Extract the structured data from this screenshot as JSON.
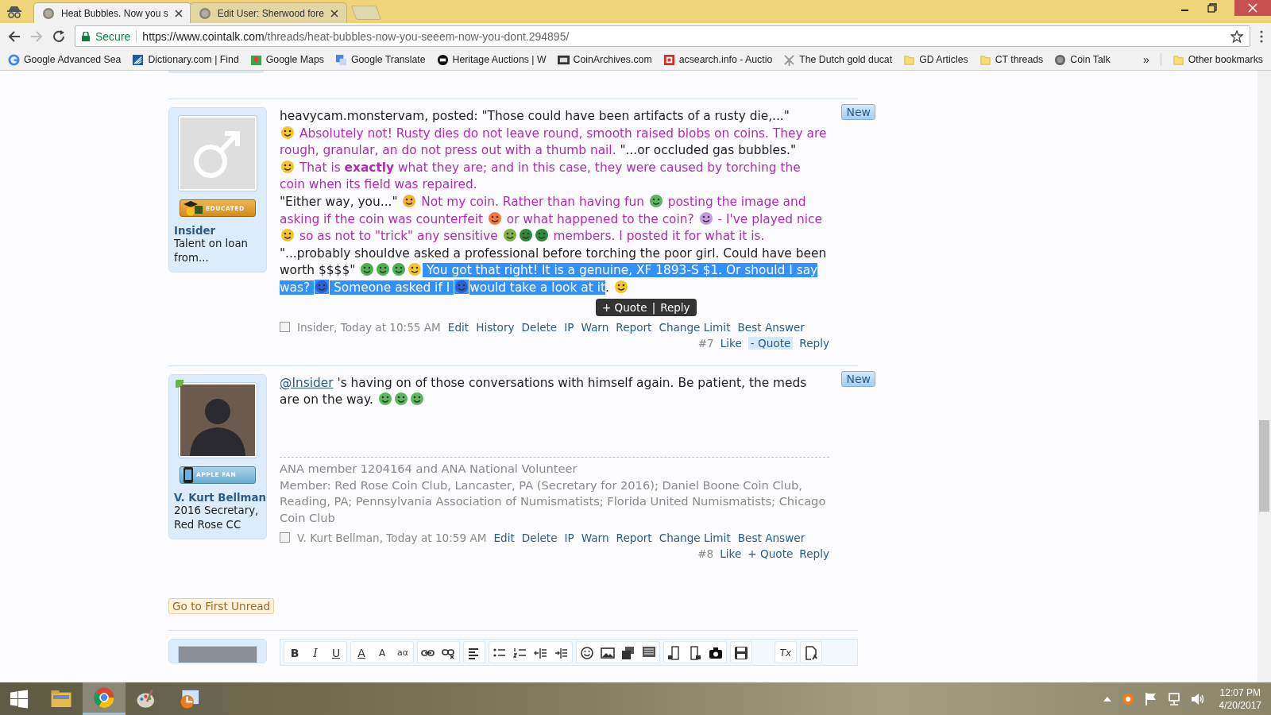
{
  "browser": {
    "tabs": [
      {
        "title": "Heat Bubbles. Now you s",
        "selected": true
      },
      {
        "title": "Edit User: Sherwood fore",
        "selected": false
      }
    ],
    "address": {
      "secure_label": "Secure",
      "url_host": "https://www.cointalk.com",
      "url_path": "/threads/heat-bubbles-now-you-seeem-now-you-dont.294895/"
    },
    "bookmarks": [
      "Google Advanced Sea",
      "Dictionary.com | Find",
      "Google Maps",
      "Google Translate",
      "Heritage Auctions | W",
      "CoinArchives.com",
      "acsearch.info - Auctio",
      "The Dutch gold ducat",
      "GD Articles",
      "CT threads",
      "Coin Talk"
    ],
    "overflow": "»",
    "other_bookmarks": "Other bookmarks"
  },
  "posts": [
    {
      "author": "Insider",
      "user_title": "Talent on loan from...",
      "avatar": {
        "kind": "default"
      },
      "online": false,
      "badge": {
        "text": "EDUCATED",
        "kind": "grad"
      },
      "new_label": "New",
      "paragraphs": [
        [
          {
            "kind": "quote",
            "text": "heavycam.monstervam, posted: \"Those could have been artifacts of a rusty die,...\"",
            "selected": false
          }
        ],
        [
          {
            "kind": "emoji",
            "color": "#f6c52c",
            "selected": false
          },
          {
            "kind": "reply",
            "text": " Absolutely not! Rusty dies do not leave round, smooth raised blobs on coins. They are rough, granular, an do not press out with a thumb nail. ",
            "selected": false
          },
          {
            "kind": "quote",
            "text": "\"...or occluded gas bubbles.\"",
            "selected": false
          }
        ],
        [
          {
            "kind": "emoji",
            "color": "#f6c52c",
            "selected": false
          },
          {
            "kind": "reply",
            "text": " That is **exactly** what they are; and in this case, they were caused by torching the coin when its field was repaired.",
            "selected": false
          }
        ],
        [
          {
            "kind": "quote",
            "text": "\"Either way, you...\" ",
            "selected": false
          },
          {
            "kind": "emoji",
            "color": "#f3b23a",
            "selected": false
          },
          {
            "kind": "reply",
            "text": " Not my coin. Rather than having fun ",
            "selected": false
          },
          {
            "kind": "emoji",
            "color": "#5cb85c",
            "selected": false
          },
          {
            "kind": "reply",
            "text": " posting the image and asking if the coin was counterfeit ",
            "selected": false
          },
          {
            "kind": "emoji",
            "color": "#f07a3a",
            "selected": false
          },
          {
            "kind": "reply",
            "text": " or what happened to the coin? ",
            "selected": false
          },
          {
            "kind": "emoji",
            "color": "#c49ae0",
            "selected": false
          },
          {
            "kind": "reply",
            "text": " - I've played nice ",
            "selected": false
          },
          {
            "kind": "emoji",
            "color": "#f6c52c",
            "selected": false
          },
          {
            "kind": "reply",
            "text": " so as not to \"trick\" any sensitive ",
            "selected": false
          },
          {
            "kind": "emoji",
            "color": "#7cb342",
            "selected": false
          },
          {
            "kind": "emoji",
            "color": "#2e8b3a",
            "selected": false
          },
          {
            "kind": "emoji",
            "color": "#2e8b3a",
            "selected": false
          },
          {
            "kind": "reply",
            "text": " members. I posted it for what it is.",
            "selected": false
          }
        ],
        [
          {
            "kind": "quote",
            "text": "\"...probably shouldve asked a professional before torching the poor girl. Could have been worth $$$$\" ",
            "selected": false
          },
          {
            "kind": "emoji",
            "color": "#4caf50",
            "selected": false
          },
          {
            "kind": "emoji",
            "color": "#4caf50",
            "selected": false
          },
          {
            "kind": "emoji",
            "color": "#4caf50",
            "selected": false
          },
          {
            "kind": "emoji",
            "color": "#f6c52c",
            "selected": false
          },
          {
            "kind": "reply",
            "text": " You got that right! It is a genuine, XF 1893-S $1. Or should I say was? ",
            "selected": true
          },
          {
            "kind": "emoji",
            "color": "#2c5fd6",
            "selected": true
          },
          {
            "kind": "reply",
            "text": " Someone asked if I ",
            "selected": true
          },
          {
            "kind": "emoji",
            "color": "#2c5fd6",
            "selected": true
          },
          {
            "kind": "reply",
            "text": "would take a look at it",
            "selected": true
          },
          {
            "kind": "quote",
            "text": ". ",
            "selected": false
          },
          {
            "kind": "emoji",
            "color": "#f6c52c",
            "selected": false
          }
        ]
      ],
      "popup": {
        "quote": "+ Quote",
        "separator": "|",
        "reply": "Reply"
      },
      "byline": "Insider, Today at 10:55 AM",
      "checked": false,
      "links": [
        "Edit",
        "History",
        "Delete",
        "IP",
        "Warn",
        "Report",
        "Change Limit",
        "Best Answer"
      ],
      "number": "#7",
      "like": "Like",
      "quote": {
        "label": "- Quote",
        "active": true
      },
      "reply": "Reply"
    },
    {
      "author": "V. Kurt Bellman",
      "user_title": "2016 Secretary, Red Rose CC",
      "avatar": {
        "kind": "photo"
      },
      "online": true,
      "badge": {
        "text": "APPLE FAN",
        "kind": "phone"
      },
      "new_label": "New",
      "paragraphs": [
        [
          {
            "kind": "mention",
            "text": "@Insider"
          },
          {
            "kind": "quote",
            "text": " 's having on of those conversations with himself again. Be patient, the meds are on the way. ",
            "selected": false
          },
          {
            "kind": "emoji",
            "color": "#5cb85c",
            "selected": false
          },
          {
            "kind": "emoji",
            "color": "#5cb85c",
            "selected": false
          },
          {
            "kind": "emoji",
            "color": "#5cb85c",
            "selected": false
          }
        ]
      ],
      "signature": [
        "ANA member 1204164 and ANA National Volunteer",
        "Member: Red Rose Coin Club, Lancaster, PA (Secretary for 2016); Daniel Boone Coin Club, Reading, PA; Pennsylvania Association of Numismatists; Florida United Numismatists; Chicago Coin Club"
      ],
      "byline": "V. Kurt Bellman, Today at 10:59 AM",
      "checked": false,
      "links": [
        "Edit",
        "Delete",
        "IP",
        "Warn",
        "Report",
        "Change Limit",
        "Best Answer"
      ],
      "number": "#8",
      "like": "Like",
      "quote": {
        "label": "+ Quote",
        "active": false
      },
      "reply": "Reply"
    }
  ],
  "first_unread": "Go to First Unread",
  "editor_toolbar": [
    [
      {
        "kind": "text",
        "label": "B"
      },
      {
        "kind": "text",
        "label": "I"
      },
      {
        "kind": "text",
        "label": "U"
      }
    ],
    [
      {
        "kind": "text",
        "label": "A"
      },
      {
        "kind": "text",
        "label": "A"
      },
      {
        "kind": "text",
        "label": "aα"
      }
    ],
    [
      {
        "kind": "icon"
      },
      {
        "kind": "icon"
      }
    ],
    [
      {
        "kind": "icon"
      }
    ],
    [
      {
        "kind": "icon"
      },
      {
        "kind": "icon"
      },
      {
        "kind": "icon"
      },
      {
        "kind": "icon"
      }
    ],
    [
      {
        "kind": "icon"
      },
      {
        "kind": "icon"
      },
      {
        "kind": "icon"
      },
      {
        "kind": "icon"
      }
    ],
    [
      {
        "kind": "icon"
      },
      {
        "kind": "icon"
      },
      {
        "kind": "icon"
      }
    ],
    [
      {
        "kind": "icon"
      }
    ],
    [
      {
        "kind": "text",
        "label": "Tx"
      }
    ],
    [
      {
        "kind": "icon"
      }
    ]
  ],
  "taskbar": {
    "apps": [
      {
        "active": false
      },
      {
        "active": true
      },
      {
        "active": false
      },
      {
        "active": false
      }
    ],
    "time": "12:07 PM",
    "date": "4/20/2017"
  }
}
